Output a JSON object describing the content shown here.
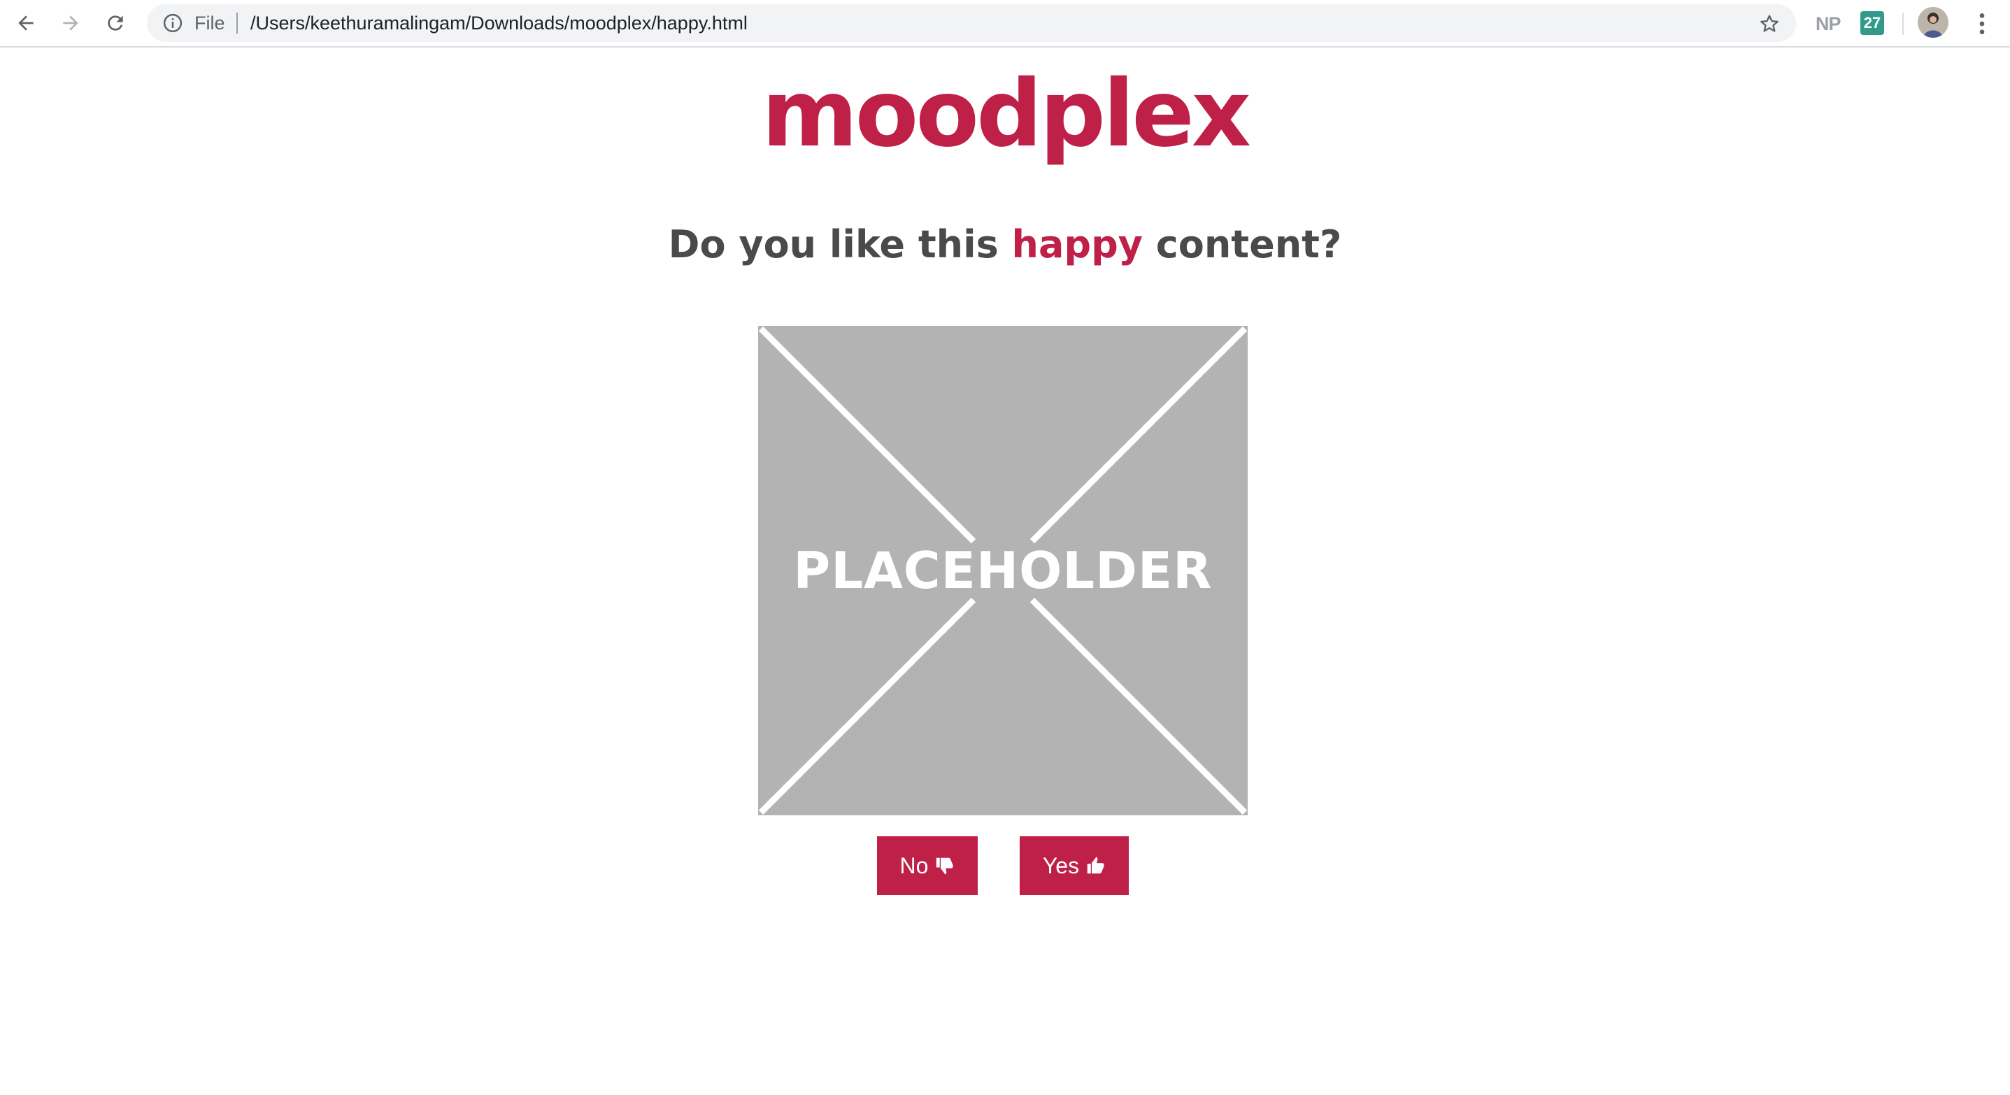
{
  "browser": {
    "back_icon": "arrow-left-icon",
    "forward_icon": "arrow-right-icon",
    "reload_icon": "reload-icon",
    "address_bar": {
      "info_icon": "info-icon",
      "scheme_label": "File",
      "url": "/Users/keethuramalingam/Downloads/moodplex/happy.html",
      "bookmark_icon": "star-icon"
    },
    "extensions": {
      "np_label": "NP",
      "calendar_label": "27"
    },
    "menu_icon": "kebab-menu-icon"
  },
  "page": {
    "logo": "moodplex",
    "question": {
      "before": "Do you like this ",
      "mood": "happy",
      "after": " content?"
    },
    "placeholder_label": "PLACEHOLDER",
    "buttons": {
      "no_label": "No",
      "no_icon": "thumbs-down-icon",
      "yes_label": "Yes",
      "yes_icon": "thumbs-up-icon"
    }
  },
  "colors": {
    "brand": "#be2048",
    "heading": "#4a4a4a",
    "placeholder_bg": "#b3b3b3"
  }
}
